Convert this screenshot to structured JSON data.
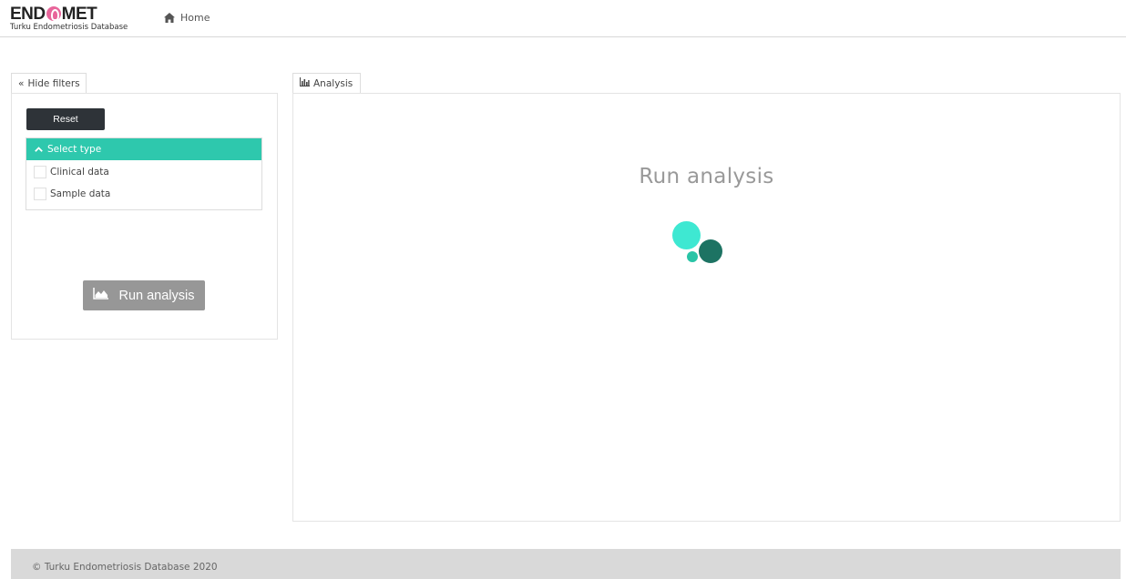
{
  "header": {
    "brand_title_left": "END",
    "brand_title_right": "MET",
    "brand_subtitle": "Turku Endometriosis Database",
    "home_label": "Home"
  },
  "filters_tab": {
    "icon_text": "«",
    "label": "Hide filters"
  },
  "filters": {
    "reset_label": "Reset",
    "select_header": "Select type",
    "options": [
      {
        "label": "Clinical data",
        "checked": false
      },
      {
        "label": "Sample data",
        "checked": false
      }
    ],
    "run_label": "Run analysis"
  },
  "analysis_tab": {
    "label": "Analysis"
  },
  "analysis": {
    "title": "Run analysis"
  },
  "colors": {
    "accent": "#2ec8ad",
    "loader_light": "#3ee8d2",
    "loader_dark": "#1d7363",
    "logo_pink": "#e8659a"
  },
  "footer": {
    "text": "© Turku Endometriosis Database 2020"
  }
}
